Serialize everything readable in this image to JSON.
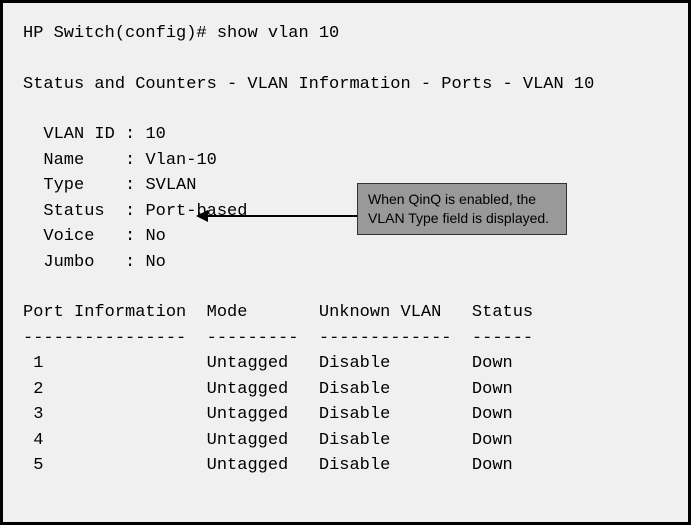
{
  "prompt": "HP Switch(config)# ",
  "command": "show vlan 10",
  "header": "Status and Counters - VLAN Information - Ports - VLAN 10",
  "fields": {
    "vlan_id": {
      "label": "VLAN ID",
      "value": "10"
    },
    "name": {
      "label": "Name",
      "value": "Vlan-10"
    },
    "type": {
      "label": "Type",
      "value": "SVLAN"
    },
    "status": {
      "label": "Status",
      "value": "Port-based"
    },
    "voice": {
      "label": "Voice",
      "value": "No"
    },
    "jumbo": {
      "label": "Jumbo",
      "value": "No"
    }
  },
  "table": {
    "headers": {
      "port_info": "Port Information",
      "mode": "Mode",
      "unknown_vlan": "Unknown VLAN",
      "status": "Status"
    },
    "separators": {
      "port_info": "----------------",
      "mode": "---------",
      "unknown_vlan": "-------------",
      "status": "------"
    },
    "rows": [
      {
        "port": "1",
        "mode": "Untagged",
        "unknown_vlan": "Disable",
        "status": "Down"
      },
      {
        "port": "2",
        "mode": "Untagged",
        "unknown_vlan": "Disable",
        "status": "Down"
      },
      {
        "port": "3",
        "mode": "Untagged",
        "unknown_vlan": "Disable",
        "status": "Down"
      },
      {
        "port": "4",
        "mode": "Untagged",
        "unknown_vlan": "Disable",
        "status": "Down"
      },
      {
        "port": "5",
        "mode": "Untagged",
        "unknown_vlan": "Disable",
        "status": "Down"
      }
    ]
  },
  "callout": "When QinQ is enabled, the VLAN Type field is displayed."
}
